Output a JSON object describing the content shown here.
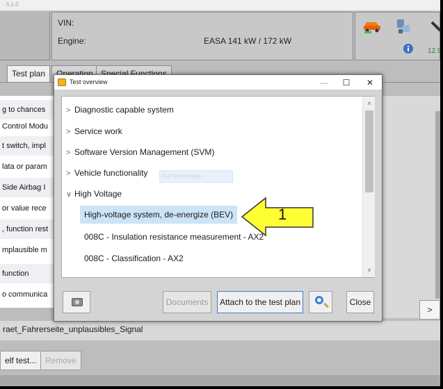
{
  "titlebar": {
    "text": "- 5.1.0"
  },
  "header": {
    "vin_label": "VIN:",
    "engine_label": "Engine:",
    "engine_value": "EASA 141 kW / 172 kW",
    "voltage": "12.9"
  },
  "tabs": [
    {
      "label": "Test plan"
    },
    {
      "label": "Operation"
    },
    {
      "label": "Special Functions"
    }
  ],
  "left_list": [
    "g to chances",
    "Control Modu",
    "t switch, impl",
    "lata or param",
    "Side Airbag I",
    "or value rece",
    ", function rest",
    "mplausible m",
    "function",
    "o communica"
  ],
  "signal_text": "raet_Fahrerseite_unplausibles_Signal",
  "bottom_buttons": {
    "self_test": "elf test...",
    "remove": "Remove"
  },
  "right_box": {
    "label": ">"
  },
  "dialog": {
    "title": "Test overview",
    "window_buttons": {
      "minimize": "—",
      "maximize": "☐",
      "close": "✕"
    },
    "items": [
      {
        "label": "Diagnostic capable system",
        "expander": ">"
      },
      {
        "label": "Service work",
        "expander": ">"
      },
      {
        "label": "Software Version Management (SVM)",
        "expander": ">"
      },
      {
        "label": "Vehicle functionality",
        "expander": ">"
      },
      {
        "label": "High Voltage",
        "expander": "∨"
      }
    ],
    "sub_items": [
      {
        "label": "High-voltage system, de-energize (BEV)"
      },
      {
        "label": "008C  - Insulation resistance measurement - AX2"
      },
      {
        "label": "008C  - Classification - AX2"
      }
    ],
    "ghost_tooltip": "Full screen help",
    "scroll_up": "˄",
    "scroll_down": "˅",
    "buttons": {
      "documents": "Documents",
      "attach": "Attach to the test plan",
      "close": "Close"
    }
  },
  "annotation": {
    "number": "1",
    "color": "#ffff33"
  },
  "colors": {
    "selection": "#cce4f7",
    "primary_border": "#3d7bd3",
    "voltage_text": "#2a7d2a"
  }
}
